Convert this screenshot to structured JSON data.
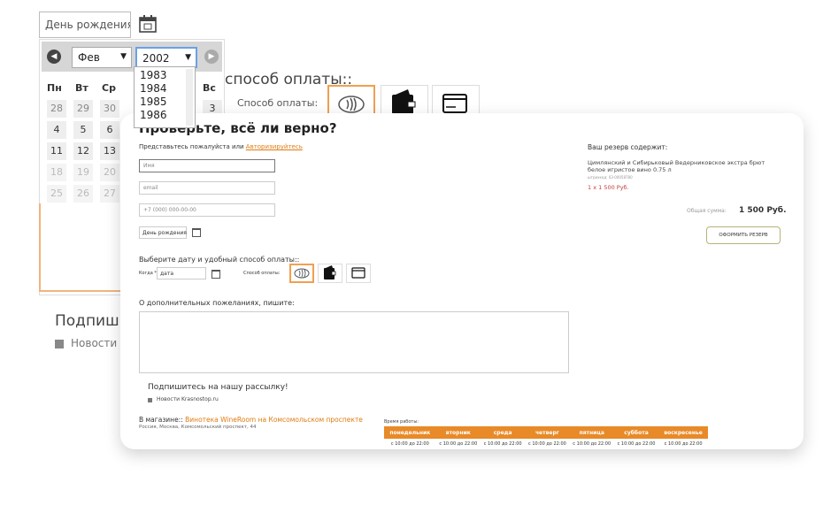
{
  "background": {
    "birthday_placeholder": "День рождения",
    "month_selected": "Фев",
    "year_selected": "2002",
    "year_options": [
      "1983",
      "1984",
      "1985",
      "1986"
    ],
    "weekdays": [
      "Пн",
      "Вт",
      "Ср",
      "Вс"
    ],
    "day_rows": [
      [
        "28",
        "29",
        "30"
      ],
      [
        "4",
        "5",
        "6"
      ],
      [
        "11",
        "12",
        "13"
      ],
      [
        "18",
        "19",
        "20"
      ],
      [
        "25",
        "26",
        "27"
      ]
    ],
    "sunday_day": "3",
    "payment_heading": "способ оплаты::",
    "payment_label": "Способ оплаты:",
    "subscribe_heading": "Подпиш",
    "subscribe_news": "Новости"
  },
  "form": {
    "title": "Проверьте, всё ли верно?",
    "intro_text": "Представьтесь пожалуйста или",
    "login_link": "Авторизируйтесь",
    "name_placeholder": "Имя",
    "email_placeholder": "email",
    "phone_placeholder": "+7 (000) 000-00-00",
    "birthday_placeholder": "День рождения",
    "choose_label": "Выберите дату и удобный способ оплаты::",
    "when_label": "Когда *",
    "date_placeholder": "дата",
    "payment_label": "Способ оплаты:",
    "wishes_label": "О дополнительных пожеланиях, пишите:",
    "subscribe_title": "Подпишитесь на нашу рассылку!",
    "subscribe_news": "Новости Krasnostop.ru",
    "store_prefix": "В магазине::",
    "store_name": "Винотека WineRoom на Комсомольском проспекте",
    "store_address": "Россия, Москва, Комсомольский проспект, 44",
    "hours_label": "Время работы:",
    "hours_days": [
      "понедельник",
      "вторник",
      "среда",
      "четверг",
      "пятница",
      "суббота",
      "воскресенье"
    ],
    "hours_values": [
      "с 10:00 до 22:00",
      "с 10:00 до 22:00",
      "с 10:00 до 22:00",
      "с 10:00 до 22:00",
      "с 10:00 до 22:00",
      "с 10:00 до 22:00",
      "с 10:00 до 22:00"
    ]
  },
  "reservation": {
    "title": "Ваш резерв содержит:",
    "item_name": "Цимлянский и Сибирьковый Ведерниковское экстра брют белое игристое вино 0.75 л",
    "item_code": "штрихкод: 03-00058780",
    "item_price": "1 x 1 500 Руб.",
    "total_label": "Общая сумма:",
    "total_value": "1 500 Руб.",
    "reserve_button": "ОФОРМИТЬ РЕЗЕРВ"
  },
  "colors": {
    "accent": "#e88a28",
    "link": "#e07b10",
    "price": "#c43b3b"
  }
}
